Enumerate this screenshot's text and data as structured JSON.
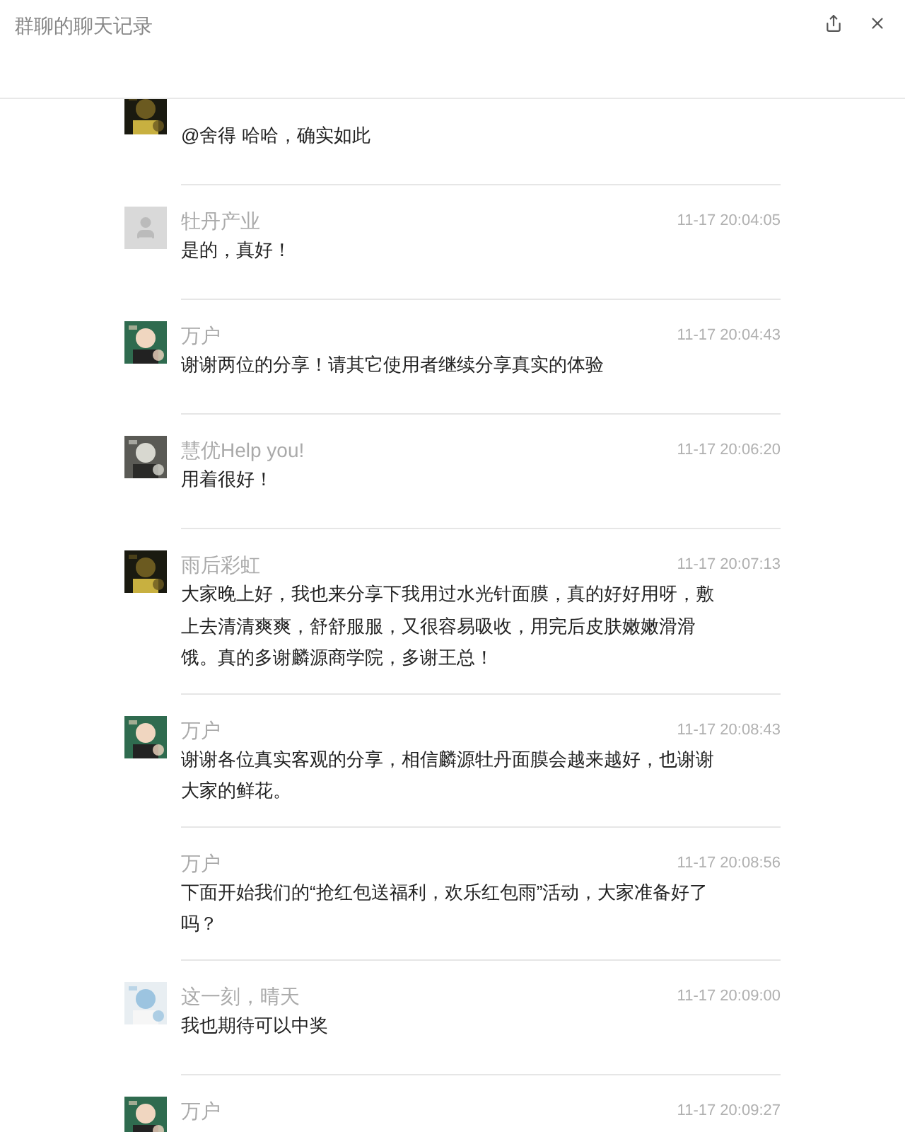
{
  "window": {
    "title": "群聊的聊天记录"
  },
  "messages": [
    {
      "text": "@舍得 哈哈，确实如此"
    },
    {
      "avatar": {
        "kind": "placeholder"
      },
      "name": "牡丹产业",
      "time": "11-17 20:04:05",
      "text": "是的，真好！"
    },
    {
      "name": "万户",
      "time": "11-17 20:04:43",
      "text": "谢谢两位的分享！请其它使用者继续分享真实的体验"
    },
    {
      "name": "慧优Help you!",
      "time": "11-17 20:06:20",
      "text": "用着很好！"
    },
    {
      "name": "雨后彩虹",
      "time": "11-17 20:07:13",
      "text": "大家晚上好，我也来分享下我用过水光针面膜，真的好好用呀，敷上去清清爽爽，舒舒服服，又很容易吸收，用完后皮肤嫩嫩滑滑饿。真的多谢麟源商学院，多谢王总！"
    },
    {
      "name": "万户",
      "time": "11-17 20:08:43",
      "text": "谢谢各位真实客观的分享，相信麟源牡丹面膜会越来越好，也谢谢大家的鲜花。"
    },
    {
      "name": "万户",
      "time": "11-17 20:08:56",
      "text": "下面开始我们的“抢红包送福利，欢乐红包雨”活动，大家准备好了吗？"
    },
    {
      "name": "这一刻，晴天",
      "time": "11-17 20:09:00",
      "text": "我也期待可以中奖"
    },
    {
      "name": "万户",
      "time": "11-17 20:09:27"
    }
  ]
}
